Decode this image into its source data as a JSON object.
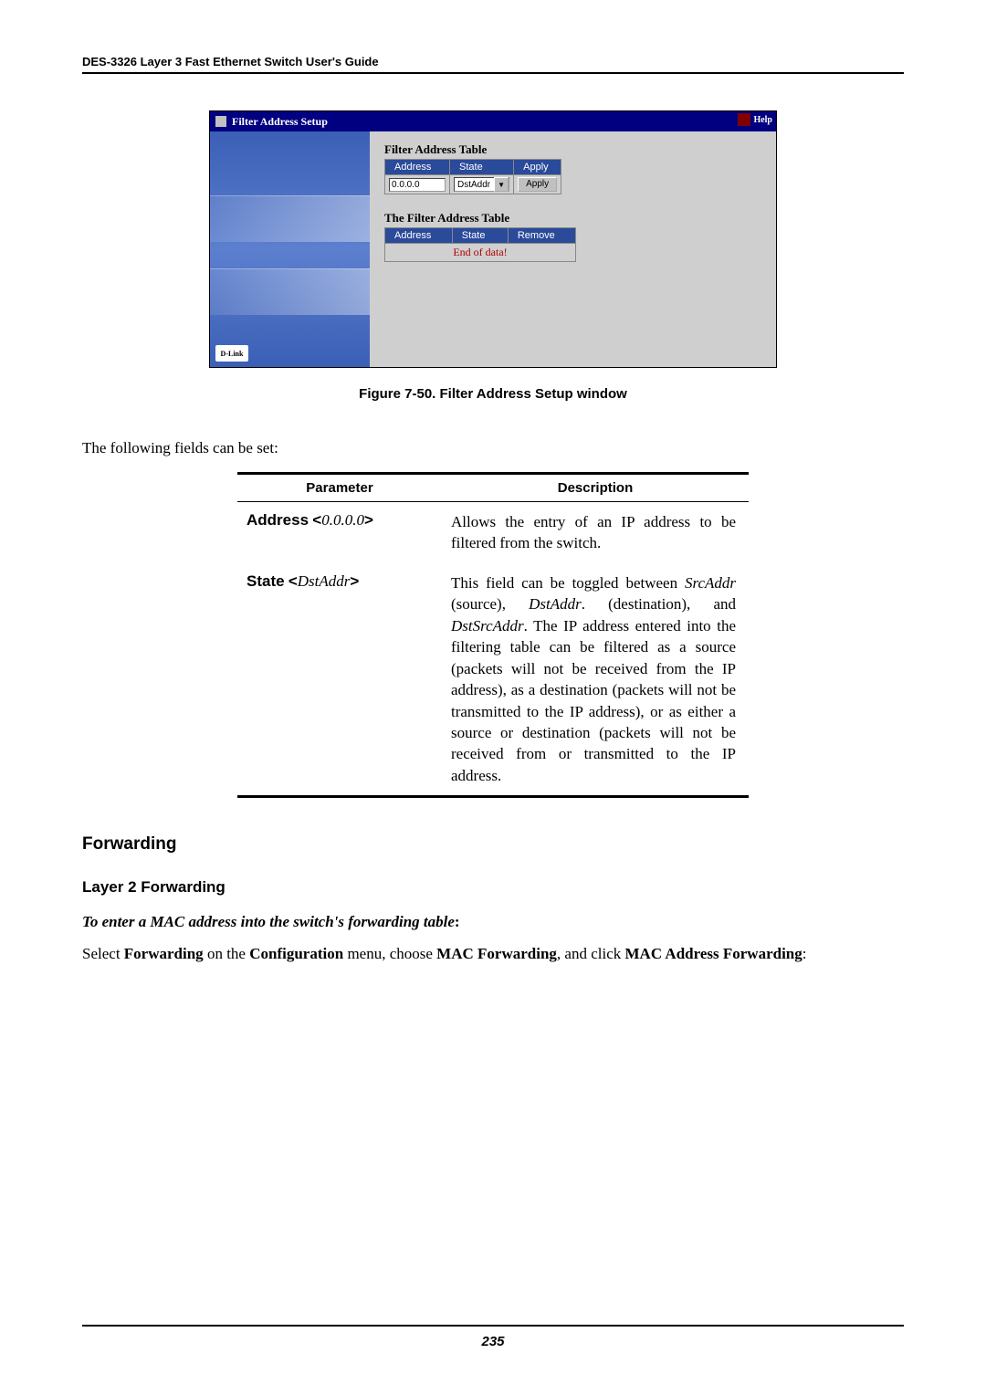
{
  "header": "DES-3326 Layer 3 Fast Ethernet Switch User's Guide",
  "screenshot": {
    "title": "Filter Address Setup",
    "help": "Help",
    "table1_title": "Filter Address Table",
    "th_address": "Address",
    "th_state": "State",
    "th_apply": "Apply",
    "th_remove": "Remove",
    "input_value": "0.0.0.0",
    "select_value": "DstAddr",
    "btn_apply": "Apply",
    "table2_title": "The Filter Address Table",
    "end_of_data": "End of data!"
  },
  "figure_caption": "Figure 7-50.  Filter Address Setup window",
  "intro_text": "The following fields can be set:",
  "param_table": {
    "head_param": "Parameter",
    "head_desc": "Description",
    "rows": [
      {
        "name": "Address",
        "val": "<0.0.0.0>",
        "desc": "Allows the entry of an IP address to be filtered from the switch."
      },
      {
        "name": "State",
        "val": "<DstAddr>",
        "desc_html": "This field can be toggled between <span class=\"italic\">SrcAddr</span> (source), <span class=\"italic\">DstAddr</span>. (destination), and <span class=\"italic\">DstSrcAddr</span>. The IP address entered into the filtering table can be filtered as a source (packets will not be received from the IP address), as a destination (packets will not be transmitted to the IP address), or as either a source or destination (packets will not be received from or transmitted to the IP address."
      }
    ]
  },
  "h_forwarding": "Forwarding",
  "h_layer2": "Layer 2 Forwarding",
  "lead_italic": "To enter a MAC address into the switch's forwarding table",
  "nav_sentence": {
    "p1": "Select ",
    "b1": "Forwarding",
    "p2": " on the ",
    "b2": "Configuration",
    "p3": " menu, choose ",
    "b3": "MAC Forwarding",
    "p4": ", and click ",
    "b4": "MAC Address Forwarding",
    "p5": ":"
  },
  "page_number": "235"
}
